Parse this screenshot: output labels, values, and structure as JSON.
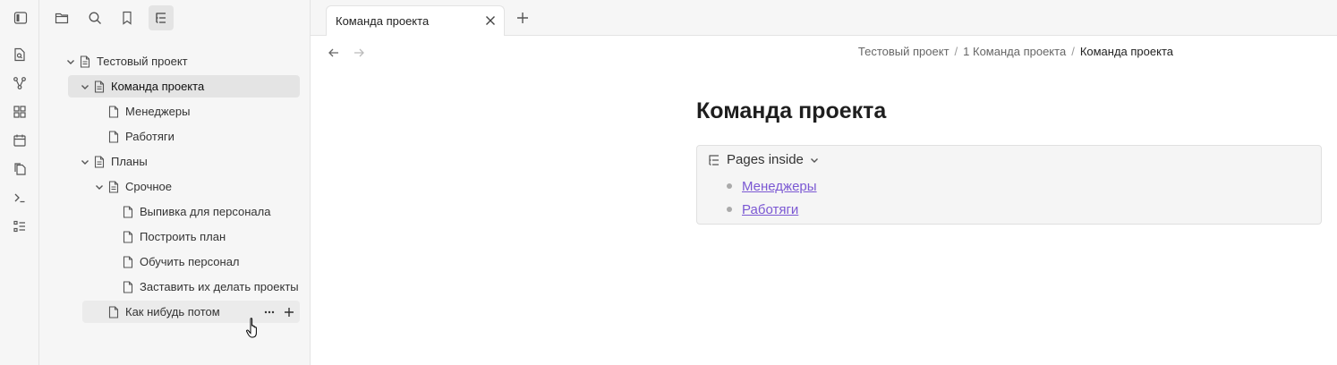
{
  "ribbon": {
    "icons": [
      "file-search-icon",
      "graph-icon",
      "blocks-icon",
      "calendar-icon",
      "copy-icon",
      "terminal-icon",
      "list-icon"
    ]
  },
  "sidebar": {
    "toolbar": [
      "sidebar-toggle-icon",
      "folder-icon",
      "search-icon",
      "bookmark-icon",
      "tree-list-icon"
    ],
    "tree": [
      {
        "label": "Тестовый проект",
        "level": 0,
        "expandable": true,
        "expanded": true
      },
      {
        "label": "Команда проекта",
        "level": 1,
        "expandable": true,
        "expanded": true,
        "selected": true
      },
      {
        "label": "Менеджеры",
        "level": 2,
        "expandable": false
      },
      {
        "label": "Работяги",
        "level": 2,
        "expandable": false
      },
      {
        "label": "Планы",
        "level": 1,
        "expandable": true,
        "expanded": true
      },
      {
        "label": "Срочное",
        "level": 2,
        "expandable": true,
        "expanded": true
      },
      {
        "label": "Выпивка для персонала",
        "level": 3,
        "expandable": false
      },
      {
        "label": "Построить план",
        "level": 3,
        "expandable": false
      },
      {
        "label": "Обучить персонал",
        "level": 3,
        "expandable": false
      },
      {
        "label": "Заставить их делать проекты",
        "level": 3,
        "expandable": false
      },
      {
        "label": "Как нибудь потом",
        "level": 2,
        "expandable": false,
        "hover": true
      }
    ]
  },
  "tab": {
    "label": "Команда проекта"
  },
  "breadcrumbs": [
    "Тестовый проект",
    "1 Команда проекта",
    "Команда проекта"
  ],
  "page": {
    "title": "Команда проекта",
    "callout_label": "Pages inside",
    "links": [
      "Менеджеры",
      "Работяги"
    ]
  },
  "colors": {
    "link": "#7b58d3",
    "selected_bg": "#e4e4e4"
  }
}
